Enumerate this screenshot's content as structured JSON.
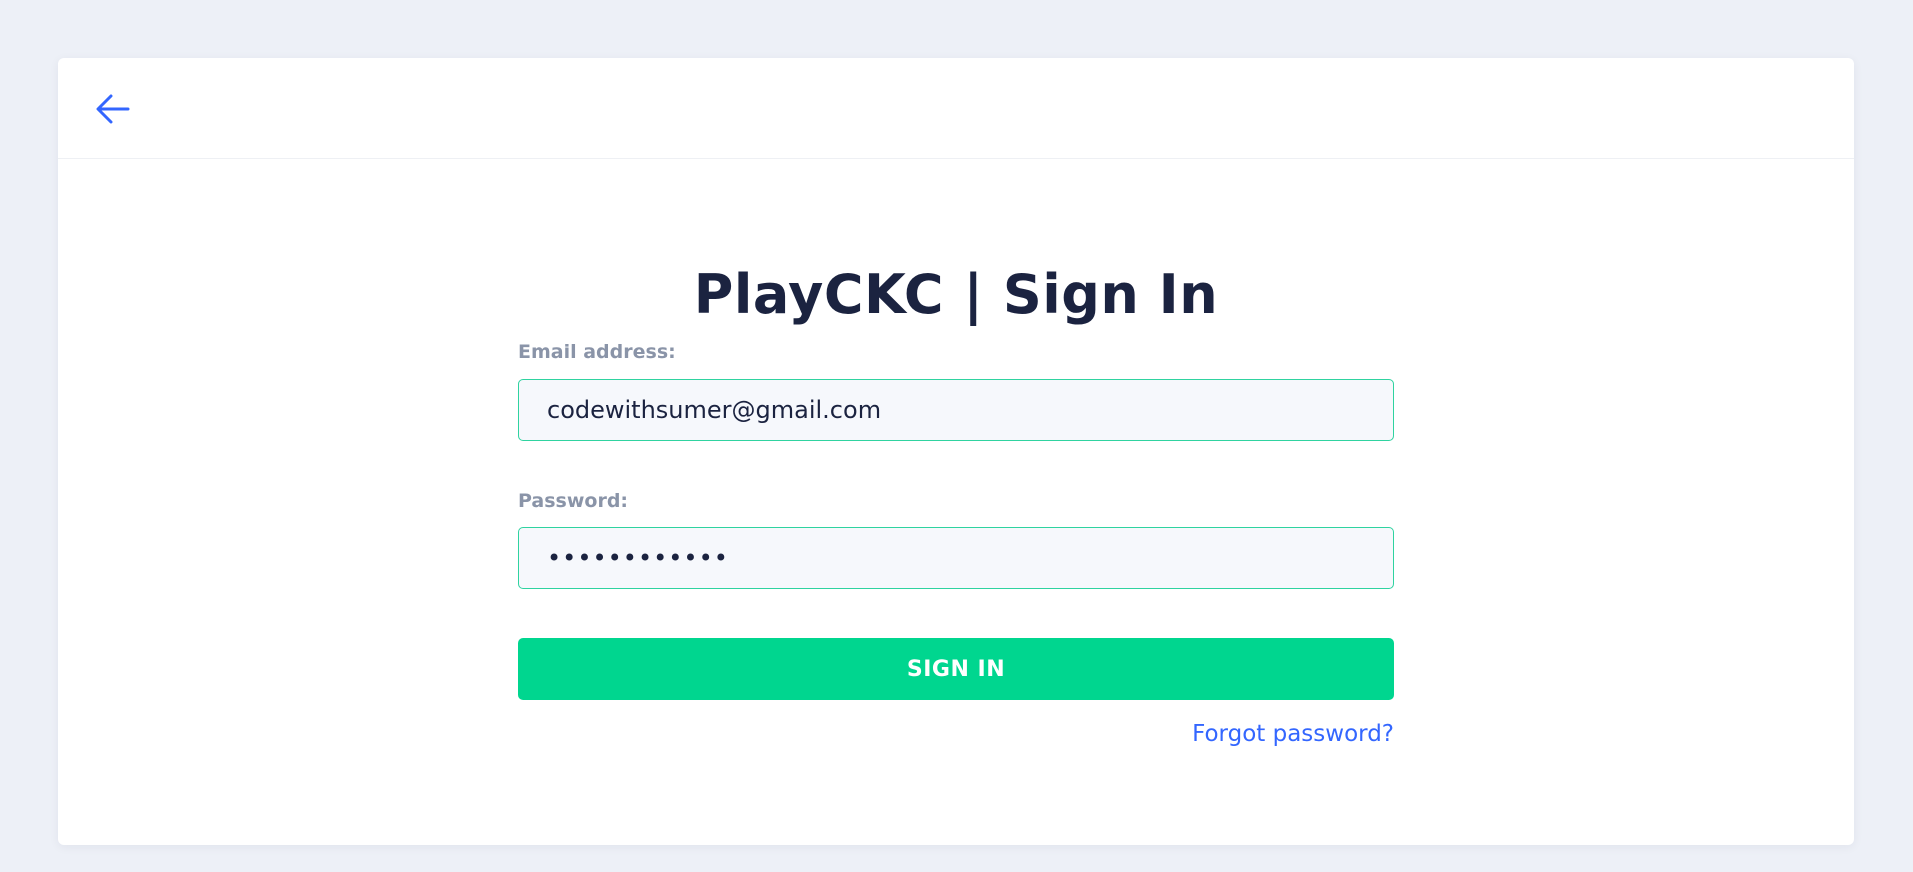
{
  "header": {
    "back_icon": "arrow-left-icon",
    "accent_color": "#3366ff"
  },
  "form": {
    "title": "PlayCKC | Sign In",
    "email_label": "Email address:",
    "email_value": "codewithsumer@gmail.com",
    "password_label": "Password:",
    "password_value": "••••••••••••",
    "submit_label": "SIGN IN",
    "forgot_label": "Forgot password?"
  },
  "colors": {
    "background": "#edf0f7",
    "card": "#ffffff",
    "title": "#1b2340",
    "label": "#8a94a8",
    "input_border": "#2fd3a0",
    "button": "#00d68f",
    "link": "#3366ff"
  }
}
